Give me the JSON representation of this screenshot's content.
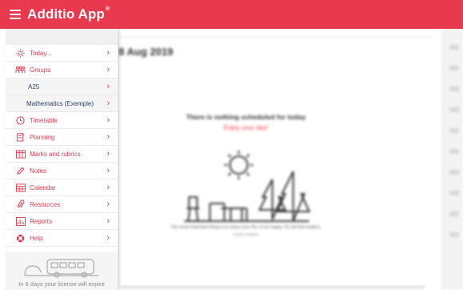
{
  "app": {
    "title": "Additio App",
    "trademark": "®"
  },
  "background": {
    "date_label": "8 Aug 2019",
    "empty_title": "There is nothing scheduled for today",
    "empty_subtitle": "Enjoy your day!",
    "quote": "The most important thing is to enjoy your life, to be happy. It's all that matters.",
    "quote_author": "Audrey Hepburn"
  },
  "sidebar": {
    "items": [
      {
        "label": "Today...",
        "icon": "sun-icon"
      },
      {
        "label": "Groups",
        "icon": "groups-icon"
      },
      {
        "label": "A25",
        "icon": ""
      },
      {
        "label": "Mathematics (Exemple)",
        "icon": ""
      },
      {
        "label": "Timetable",
        "icon": "clock-icon"
      },
      {
        "label": "Planning",
        "icon": "planning-icon"
      },
      {
        "label": "Marks and rubrics",
        "icon": "grades-icon"
      },
      {
        "label": "Notes",
        "icon": "pencil-icon"
      },
      {
        "label": "Calendar",
        "icon": "calendar-icon"
      },
      {
        "label": "Resources",
        "icon": "paperclip-icon"
      },
      {
        "label": "Reports",
        "icon": "chart-icon"
      },
      {
        "label": "Help",
        "icon": "lifebuoy-icon"
      }
    ],
    "chevron": "›",
    "footer_text": "In 6 days your license will expire"
  },
  "colors": {
    "accent": "#e8394f",
    "navy": "#2b3f6c"
  }
}
